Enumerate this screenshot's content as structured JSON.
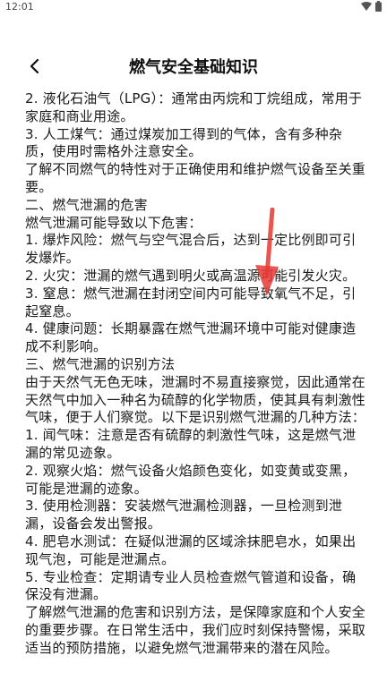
{
  "status_bar": {
    "time": "12:01"
  },
  "header": {
    "title": "燃气安全基础知识"
  },
  "article": {
    "lines": [
      "2. 液化石油气（LPG）：通常由丙烷和丁烷组成，常用于家庭和商业用途。",
      "3. 人工煤气：通过煤炭加工得到的气体，含有多种杂质，使用时需格外注意安全。",
      "了解不同燃气的特性对于正确使用和维护燃气设备至关重要。",
      "二、燃气泄漏的危害",
      "燃气泄漏可能导致以下危害：",
      "1. 爆炸风险：燃气与空气混合后，达到一定比例即可引发爆炸。",
      "2. 火灾：泄漏的燃气遇到明火或高温源可能引发火灾。",
      "3. 窒息：燃气泄漏在封闭空间内可能导致氧气不足，引起窒息。",
      "4. 健康问题：长期暴露在燃气泄漏环境中可能对健康造成不利影响。",
      "三、燃气泄漏的识别方法",
      "由于天然气无色无味，泄漏时不易直接察觉，因此通常在天然气中加入一种名为硫醇的化学物质，使其具有刺激性气味，便于人们察觉。以下是识别燃气泄漏的几种方法：",
      "1. 闻气味：注意是否有硫醇的刺激性气味，这是燃气泄漏的常见迹象。",
      "2. 观察火焰：燃气设备火焰颜色变化，如变黄或变黑，可能是泄漏的迹象。",
      "3. 使用检测器：安装燃气泄漏检测器，一旦检测到泄漏，设备会发出警报。",
      "4. 肥皂水测试：在疑似泄漏的区域涂抹肥皂水，如果出现气泡，可能是泄漏点。",
      "5. 专业检查：定期请专业人员检查燃气管道和设备，确保没有泄漏。",
      "了解燃气泄漏的危害和识别方法，是保障家庭和个人安全的重要步骤。在日常生活中，我们应时刻保持警惕，采取适当的预防措施，以避免燃气泄漏带来的潜在风险。"
    ]
  },
  "colors": {
    "overlay_arrow": "#e53935"
  }
}
